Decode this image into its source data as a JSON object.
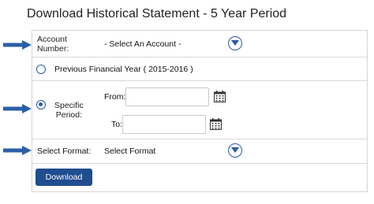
{
  "page": {
    "title": "Download Historical Statement - 5 Year Period"
  },
  "account": {
    "label": "Account Number:",
    "label_line1": "Account",
    "label_line2": "Number:",
    "value": "- Select An Account -"
  },
  "period_options": {
    "previous_year_label": "Previous Financial Year ( 2015-2016 )",
    "previous_year_selected": false,
    "specific_label_line1": "Specific",
    "specific_label_line2": "Period:",
    "specific_selected": true,
    "from_label": "From:",
    "to_label": "To:",
    "from_value": "",
    "to_value": ""
  },
  "format": {
    "label": "Select Format:",
    "value": "Select Format"
  },
  "actions": {
    "download_label": "Download"
  },
  "colors": {
    "accent": "#2a5aa8",
    "button": "#1f4d8f",
    "arrow": "#2c5fa8"
  },
  "icons": {
    "dropdown": "chevron-down-circle-icon",
    "calendar": "calendar-icon",
    "pointer": "arrow-right-icon"
  }
}
